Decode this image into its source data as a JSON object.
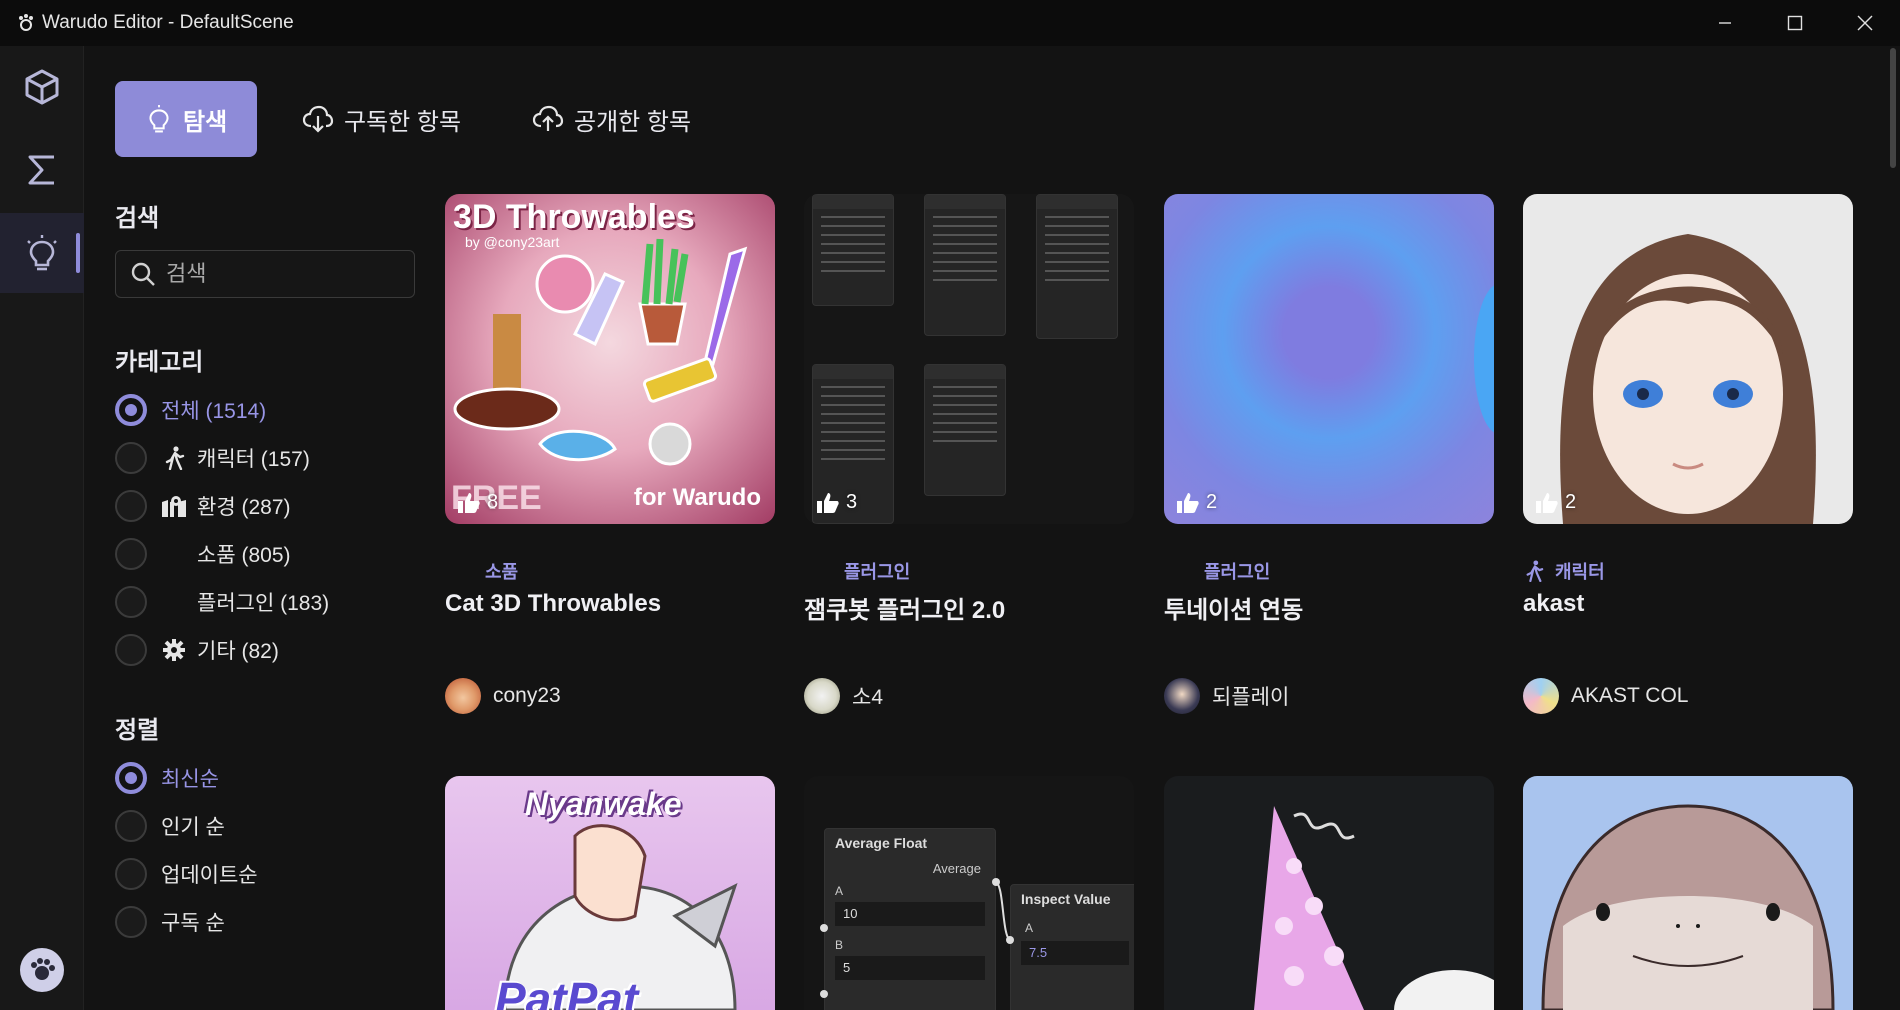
{
  "window": {
    "title": "Warudo Editor - DefaultScene"
  },
  "rail": {
    "items": [
      {
        "icon": "cube-icon"
      },
      {
        "icon": "sigma-icon"
      },
      {
        "icon": "lightbulb-icon"
      }
    ],
    "bottom_icon": "paw-logo-icon"
  },
  "tabs": [
    {
      "label": "탐색",
      "icon": "lightbulb-icon",
      "active": true
    },
    {
      "label": "구독한 항목",
      "icon": "cloud-download-icon",
      "active": false
    },
    {
      "label": "공개한 항목",
      "icon": "cloud-upload-icon",
      "active": false
    }
  ],
  "search": {
    "heading": "검색",
    "placeholder": "검색"
  },
  "categories": {
    "heading": "카테고리",
    "items": [
      {
        "label": "전체 (1514)",
        "icon": "",
        "checked": true
      },
      {
        "label": "캐릭터 (157)",
        "icon": "walking-person-icon",
        "checked": false
      },
      {
        "label": "환경 (287)",
        "icon": "map-pin-icon",
        "checked": false
      },
      {
        "label": "소품 (805)",
        "icon": "",
        "checked": false
      },
      {
        "label": "플러그인 (183)",
        "icon": "",
        "checked": false
      },
      {
        "label": "기타 (82)",
        "icon": "gear-icon",
        "checked": false
      }
    ]
  },
  "sort": {
    "heading": "정렬",
    "items": [
      {
        "label": "최신순",
        "checked": true
      },
      {
        "label": "인기 순",
        "checked": false
      },
      {
        "label": "업데이트순",
        "checked": false
      },
      {
        "label": "구독 순",
        "checked": false
      }
    ]
  },
  "cards": [
    {
      "title": "Cat 3D Throwables",
      "category": "소품",
      "likes": "8",
      "author": "cony23",
      "thumb_text": {
        "headline": "3D Throwables",
        "by": "by @cony23art",
        "free": "FREE",
        "for": "for Warudo"
      }
    },
    {
      "title": "잼쿠봇 플러그인 2.0",
      "category": "플러그인",
      "likes": "3",
      "author": "소4"
    },
    {
      "title": "투네이션 연동",
      "category": "플러그인",
      "likes": "2",
      "author": "되플레이"
    },
    {
      "title": "akast",
      "category": "캐릭터",
      "likes": "2",
      "author": "AKAST COL"
    }
  ],
  "second_row": {
    "nyanwake": {
      "top": "Nyanwake",
      "bottom": "PatPat"
    },
    "average_node": {
      "title": "Average Float",
      "output": "Average",
      "a_label": "A",
      "a_value": "10",
      "b_label": "B",
      "b_value": "5"
    },
    "inspect_node": {
      "title": "Inspect Value",
      "a_label": "A",
      "a_value": "7.5"
    }
  },
  "colors": {
    "accent": "#8e8bd8",
    "background": "#131313"
  }
}
